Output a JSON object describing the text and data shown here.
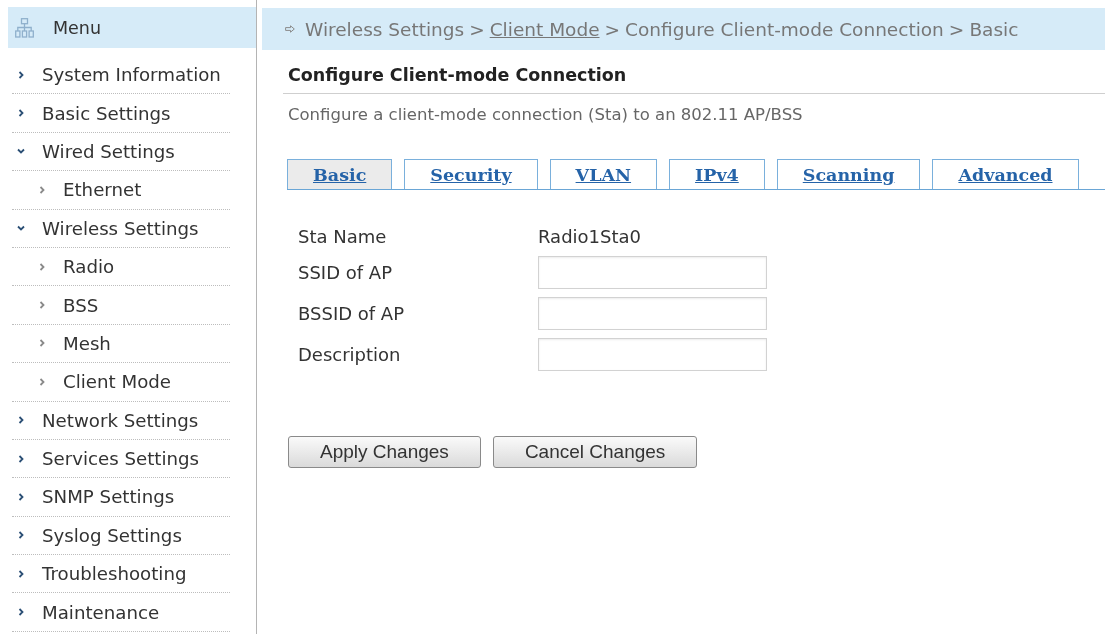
{
  "sidebar": {
    "title": "Menu",
    "items": [
      {
        "label": "System Information",
        "expanded": false
      },
      {
        "label": "Basic Settings",
        "expanded": false
      },
      {
        "label": "Wired Settings",
        "expanded": true,
        "children": [
          {
            "label": "Ethernet",
            "expanded": false
          }
        ]
      },
      {
        "label": "Wireless Settings",
        "expanded": true,
        "children": [
          {
            "label": "Radio",
            "expanded": false
          },
          {
            "label": "BSS",
            "expanded": false
          },
          {
            "label": "Mesh",
            "expanded": false
          },
          {
            "label": "Client Mode",
            "expanded": false
          }
        ]
      },
      {
        "label": "Network Settings",
        "expanded": false
      },
      {
        "label": "Services Settings",
        "expanded": false
      },
      {
        "label": "SNMP Settings",
        "expanded": false
      },
      {
        "label": "Syslog Settings",
        "expanded": false
      },
      {
        "label": "Troubleshooting",
        "expanded": false
      },
      {
        "label": "Maintenance",
        "expanded": false
      }
    ]
  },
  "breadcrumb": [
    {
      "kind": "text",
      "text": "Wireless Settings"
    },
    {
      "kind": "separator",
      "text": ">"
    },
    {
      "kind": "link",
      "text": "Client Mode"
    },
    {
      "kind": "separator",
      "text": ">"
    },
    {
      "kind": "text",
      "text": "Configure Client-mode Connection"
    },
    {
      "kind": "separator",
      "text": ">"
    },
    {
      "kind": "text",
      "text": "Basic"
    }
  ],
  "page": {
    "title": "Configure Client-mode Connection",
    "description": "Configure a client-mode connection (Sta) to an 802.11 AP/BSS"
  },
  "tabs": [
    {
      "label": "Basic",
      "selected": true
    },
    {
      "label": "Security",
      "selected": false
    },
    {
      "label": "VLAN",
      "selected": false
    },
    {
      "label": "IPv4",
      "selected": false
    },
    {
      "label": "Scanning",
      "selected": false
    },
    {
      "label": "Advanced",
      "selected": false
    }
  ],
  "form": {
    "fields": [
      {
        "kind": "text",
        "label": "Sta Name",
        "value": "Radio1Sta0"
      },
      {
        "kind": "input",
        "label": "SSID of AP"
      },
      {
        "kind": "input",
        "label": "BSSID of AP"
      },
      {
        "kind": "input",
        "label": "Description"
      }
    ]
  },
  "buttons": [
    "Apply Changes",
    "Cancel Changes"
  ]
}
